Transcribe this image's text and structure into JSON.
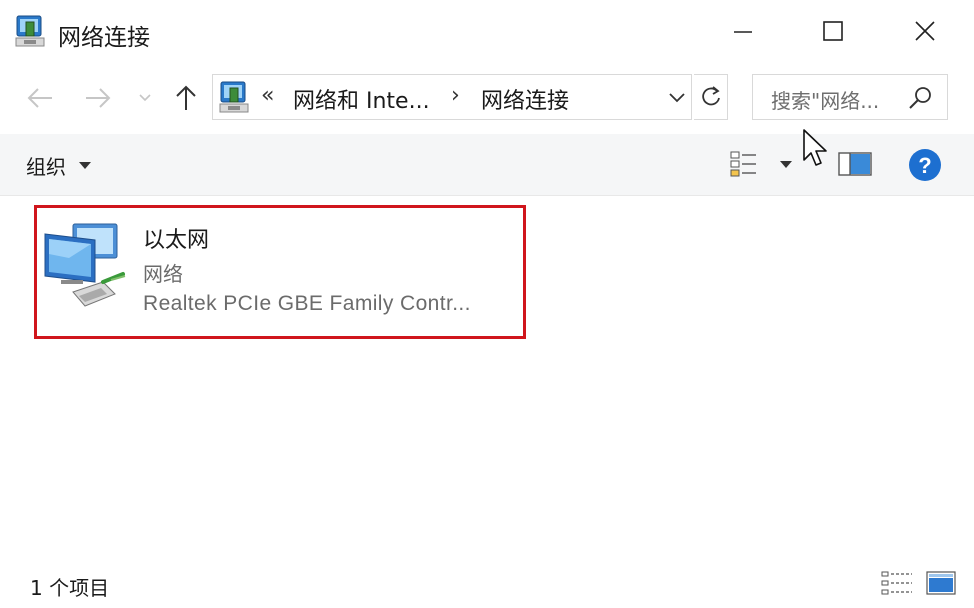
{
  "window": {
    "title": "网络连接"
  },
  "address": {
    "overflow": "«",
    "crumbs": [
      "网络和 Inte...",
      "网络连接"
    ],
    "separator": "›"
  },
  "search": {
    "placeholder": "搜索\"网络..."
  },
  "commandbar": {
    "organize_label": "组织"
  },
  "items": [
    {
      "name": "以太网",
      "type": "网络",
      "description": "Realtek PCIe GBE Family Contr...",
      "icon": "network-adapter-icon",
      "selected_outline_color": "#d0151c"
    }
  ],
  "status": {
    "count_text": "1 个项目"
  },
  "colors": {
    "help_blue": "#1d6fd0",
    "highlight_red": "#d0151c"
  }
}
